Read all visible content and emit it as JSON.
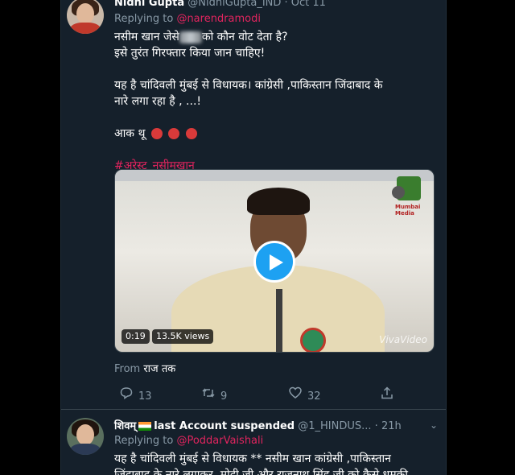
{
  "tweet1": {
    "name": "Nidhi Gupta",
    "handle": "@NidhiGupta_IND · Oct 11",
    "replying_label": "Replying to",
    "replying_to": "@narendramodi",
    "line1_pre": "नसीम खान जेसे",
    "line1_post": "को कौन वोट देता है?",
    "line2": "इसे तुरंत गिरफ्तार किया जान चाहिए!",
    "line3": "यह है चांदिवली मुंबई से विधायक। कांग्रेसी ,पाकिस्तान जिंदाबाद के",
    "line4": "नारे लगा रहा है , ...!",
    "line5": "आक थू",
    "hashtag": "#अरेस्ट_नसीमखान",
    "video_time": "0:19",
    "video_views": "13.5K views",
    "watermark": "VivaVideo",
    "from_label": "From",
    "from_source": "राज तक",
    "reply_count": "13",
    "retweet_count": "9",
    "like_count": "32",
    "icons": [
      "reply-icon",
      "retweet-icon",
      "like-icon",
      "share-icon"
    ]
  },
  "tweet2": {
    "name_pre": "शिवम्",
    "name_post": "last Account suspended",
    "handle": "@1_HINDUS... · 21h",
    "replying_label": "Replying to",
    "replying_to": "@PoddarVaishali",
    "line1": "यह है चांदिवली मुंबई से विधायक ** नसीम खान कांग्रेसी ,पाकिस्तान",
    "line2": "जिंदाबाद के नारे लगाकर, मोदी जी और राजनाथ सिंह जी को कैसे धमकी"
  },
  "colors": {
    "background": "#15202b",
    "link": "#e0245e",
    "accent": "#1da1f2",
    "muted": "#8899a6"
  }
}
